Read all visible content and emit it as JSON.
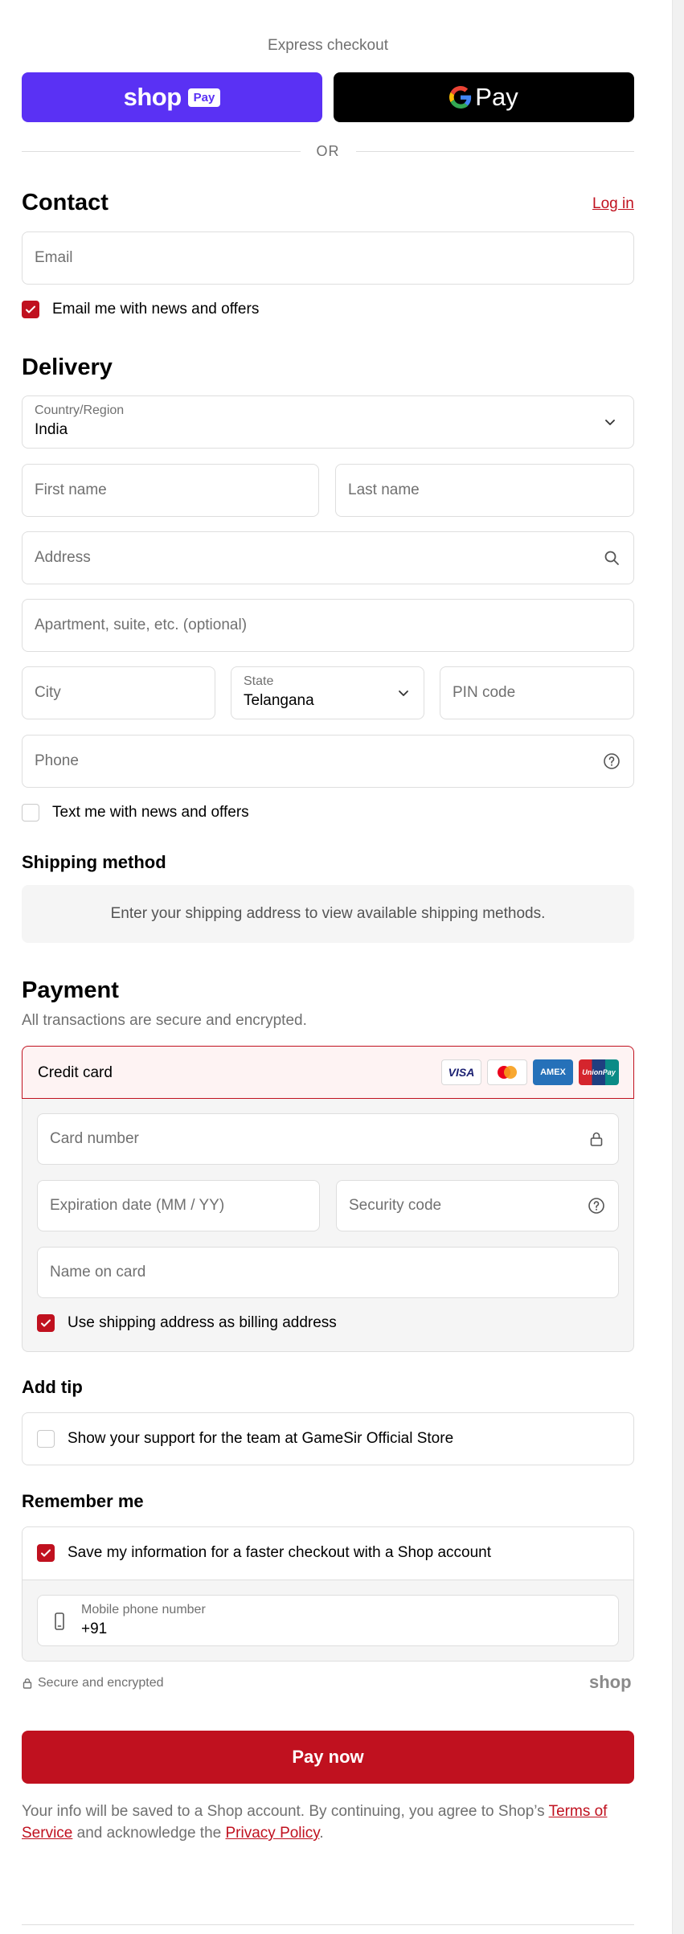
{
  "express": {
    "title": "Express checkout",
    "shop_pay_word": "shop",
    "shop_pay_badge": "Pay",
    "gpay_label": "Pay",
    "or": "OR"
  },
  "contact": {
    "heading": "Contact",
    "login": "Log in",
    "email_placeholder": "Email",
    "news_checkbox": {
      "label": "Email me with news and offers",
      "checked": true
    }
  },
  "delivery": {
    "heading": "Delivery",
    "country": {
      "label": "Country/Region",
      "value": "India"
    },
    "first_name_placeholder": "First name",
    "last_name_placeholder": "Last name",
    "address_placeholder": "Address",
    "apartment_placeholder": "Apartment, suite, etc. (optional)",
    "city_placeholder": "City",
    "state": {
      "label": "State",
      "value": "Telangana"
    },
    "pin_placeholder": "PIN code",
    "phone_placeholder": "Phone",
    "text_checkbox": {
      "label": "Text me with news and offers",
      "checked": false
    }
  },
  "shipping": {
    "heading": "Shipping method",
    "message": "Enter your shipping address to view available shipping methods."
  },
  "payment": {
    "heading": "Payment",
    "subtitle": "All transactions are secure and encrypted.",
    "method_label": "Credit card",
    "card_brands": [
      "VISA",
      "Mastercard",
      "AMEX",
      "UnionPay"
    ],
    "card_number_placeholder": "Card number",
    "expiry_placeholder": "Expiration date (MM / YY)",
    "security_placeholder": "Security code",
    "name_placeholder": "Name on card",
    "billing_checkbox": {
      "label": "Use shipping address as billing address",
      "checked": true
    }
  },
  "tip": {
    "heading": "Add tip",
    "checkbox": {
      "label": "Show your support for the team at GameSir Official Store",
      "checked": false
    }
  },
  "remember": {
    "heading": "Remember me",
    "checkbox": {
      "label": "Save my information for a faster checkout with a Shop account",
      "checked": true
    },
    "mobile": {
      "label": "Mobile phone number",
      "value": "+91"
    }
  },
  "footer": {
    "secure": "Secure and encrypted",
    "shop_logo": "shop",
    "pay_now": "Pay now",
    "legal_prefix": "Your info will be saved to a Shop account. By continuing, you agree to Shop’s ",
    "terms": "Terms of Service",
    "legal_middle": " and acknowledge the ",
    "privacy": "Privacy Policy",
    "legal_suffix": "."
  },
  "colors": {
    "accent": "#c0111f",
    "shop_pay": "#5a31f4",
    "gpay": "#000000",
    "field_border": "#dedede",
    "muted_text": "#707070",
    "panel_bg": "#f5f5f5"
  }
}
